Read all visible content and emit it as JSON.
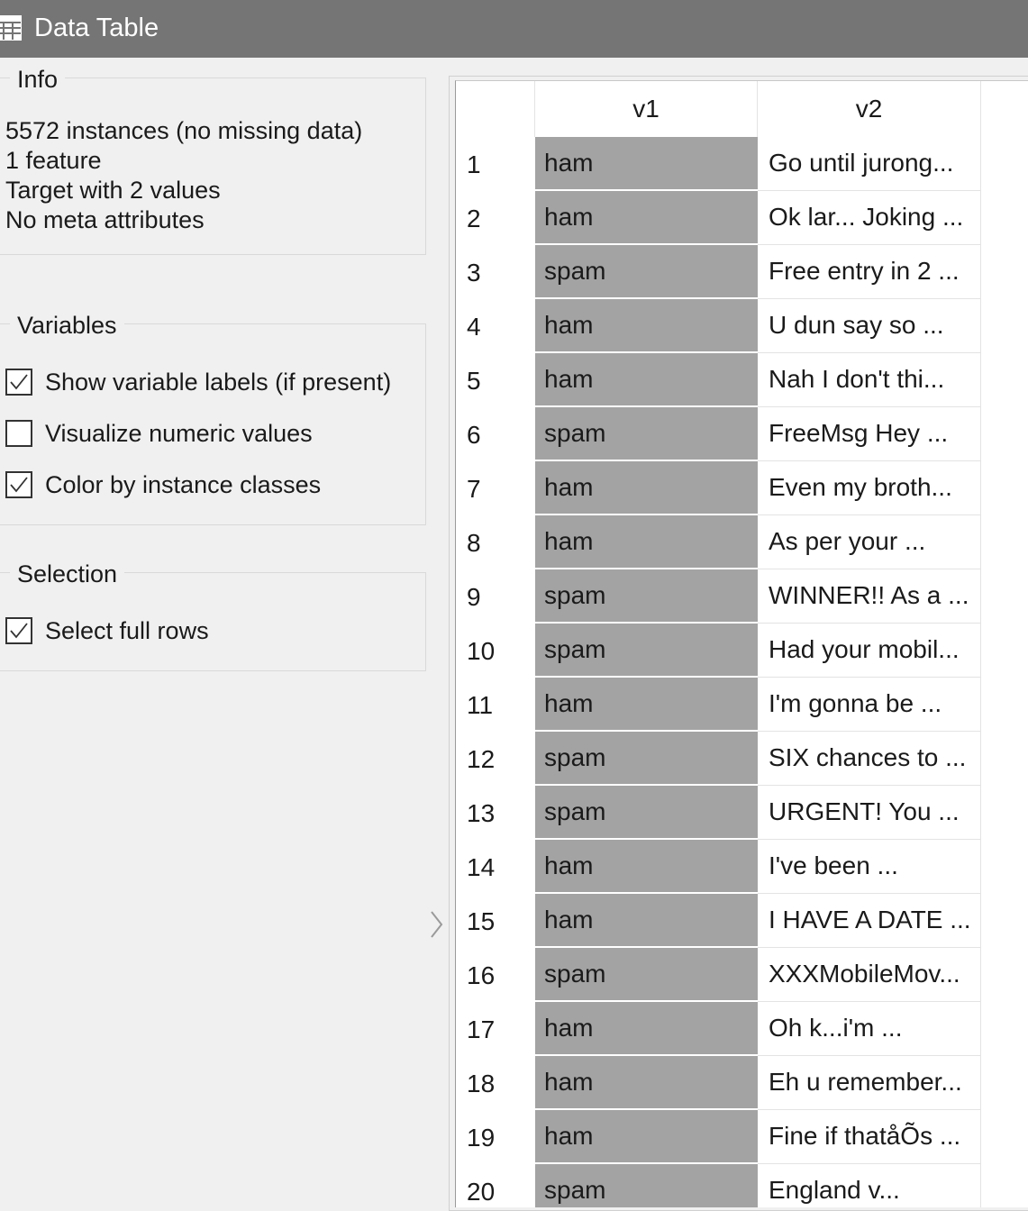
{
  "window": {
    "title": "Data Table"
  },
  "info": {
    "legend": "Info",
    "lines": [
      "5572 instances (no missing data)",
      "1 feature",
      "Target with 2 values",
      "No meta attributes"
    ]
  },
  "variables": {
    "legend": "Variables",
    "options": [
      {
        "label": "Show variable labels (if present)",
        "checked": true
      },
      {
        "label": "Visualize numeric values",
        "checked": false
      },
      {
        "label": "Color by instance classes",
        "checked": true
      }
    ]
  },
  "selection": {
    "legend": "Selection",
    "options": [
      {
        "label": "Select full rows",
        "checked": true
      }
    ]
  },
  "table": {
    "columns": [
      "v1",
      "v2"
    ],
    "rows": [
      {
        "n": "1",
        "v1": "ham",
        "v2": "Go until jurong..."
      },
      {
        "n": "2",
        "v1": "ham",
        "v2": "Ok lar... Joking ..."
      },
      {
        "n": "3",
        "v1": "spam",
        "v2": "Free entry in 2 ..."
      },
      {
        "n": "4",
        "v1": "ham",
        "v2": "U dun say so ..."
      },
      {
        "n": "5",
        "v1": "ham",
        "v2": "Nah I don't thi..."
      },
      {
        "n": "6",
        "v1": "spam",
        "v2": "FreeMsg Hey ..."
      },
      {
        "n": "7",
        "v1": "ham",
        "v2": "Even my broth..."
      },
      {
        "n": "8",
        "v1": "ham",
        "v2": "As per your ..."
      },
      {
        "n": "9",
        "v1": "spam",
        "v2": "WINNER!! As a ..."
      },
      {
        "n": "10",
        "v1": "spam",
        "v2": "Had your mobil..."
      },
      {
        "n": "11",
        "v1": "ham",
        "v2": "I'm gonna be ..."
      },
      {
        "n": "12",
        "v1": "spam",
        "v2": "SIX chances to ..."
      },
      {
        "n": "13",
        "v1": "spam",
        "v2": "URGENT! You ..."
      },
      {
        "n": "14",
        "v1": "ham",
        "v2": "I've been ..."
      },
      {
        "n": "15",
        "v1": "ham",
        "v2": "I HAVE A DATE ..."
      },
      {
        "n": "16",
        "v1": "spam",
        "v2": "XXXMobileMov..."
      },
      {
        "n": "17",
        "v1": "ham",
        "v2": "Oh k...i'm ..."
      },
      {
        "n": "18",
        "v1": "ham",
        "v2": "Eh u remember..."
      },
      {
        "n": "19",
        "v1": "ham",
        "v2": "Fine if thatåÕs ..."
      },
      {
        "n": "20",
        "v1": "spam",
        "v2": "England v..."
      }
    ]
  },
  "colors": {
    "titlebar": "#757575",
    "class_cell": "#a3a3a3",
    "panel": "#f0f0f0"
  },
  "icons": {
    "window": "table-icon",
    "splitter": "chevron-right-icon",
    "check": "checkmark-icon"
  }
}
